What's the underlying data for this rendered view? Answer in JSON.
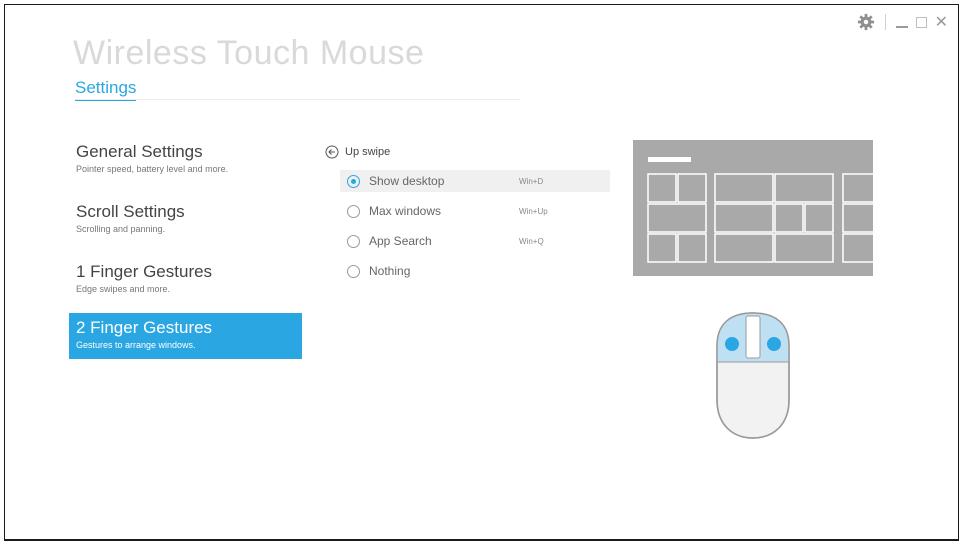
{
  "window": {
    "title": "Wireless Touch Mouse",
    "controls": {
      "settings_icon": "gear-icon",
      "minimize_icon": "minimize-icon",
      "maximize_icon": "maximize-icon",
      "close_icon": "close-icon",
      "close_glyph": "✕"
    }
  },
  "header": {
    "tab_label": "Settings"
  },
  "nav": {
    "items": [
      {
        "title": "General Settings",
        "desc": "Pointer speed, battery level and more."
      },
      {
        "title": "Scroll Settings",
        "desc": "Scrolling and panning."
      },
      {
        "title": "1 Finger Gestures",
        "desc": "Edge swipes and more."
      },
      {
        "title": "2 Finger Gestures",
        "desc": "Gestures to arrange windows."
      }
    ],
    "active_index": 3
  },
  "options": {
    "heading": "Up swipe",
    "choices": [
      {
        "label": "Show desktop",
        "shortcut": "Win+D",
        "selected": true
      },
      {
        "label": "Max windows",
        "shortcut": "Win+Up",
        "selected": false
      },
      {
        "label": "App Search",
        "shortcut": "Win+Q",
        "selected": false
      },
      {
        "label": "Nothing",
        "shortcut": "",
        "selected": false
      }
    ]
  },
  "colors": {
    "accent": "#2aa7e2",
    "preview_bg": "#a9a9a9",
    "mouse_highlight": "#bfe0f2"
  }
}
